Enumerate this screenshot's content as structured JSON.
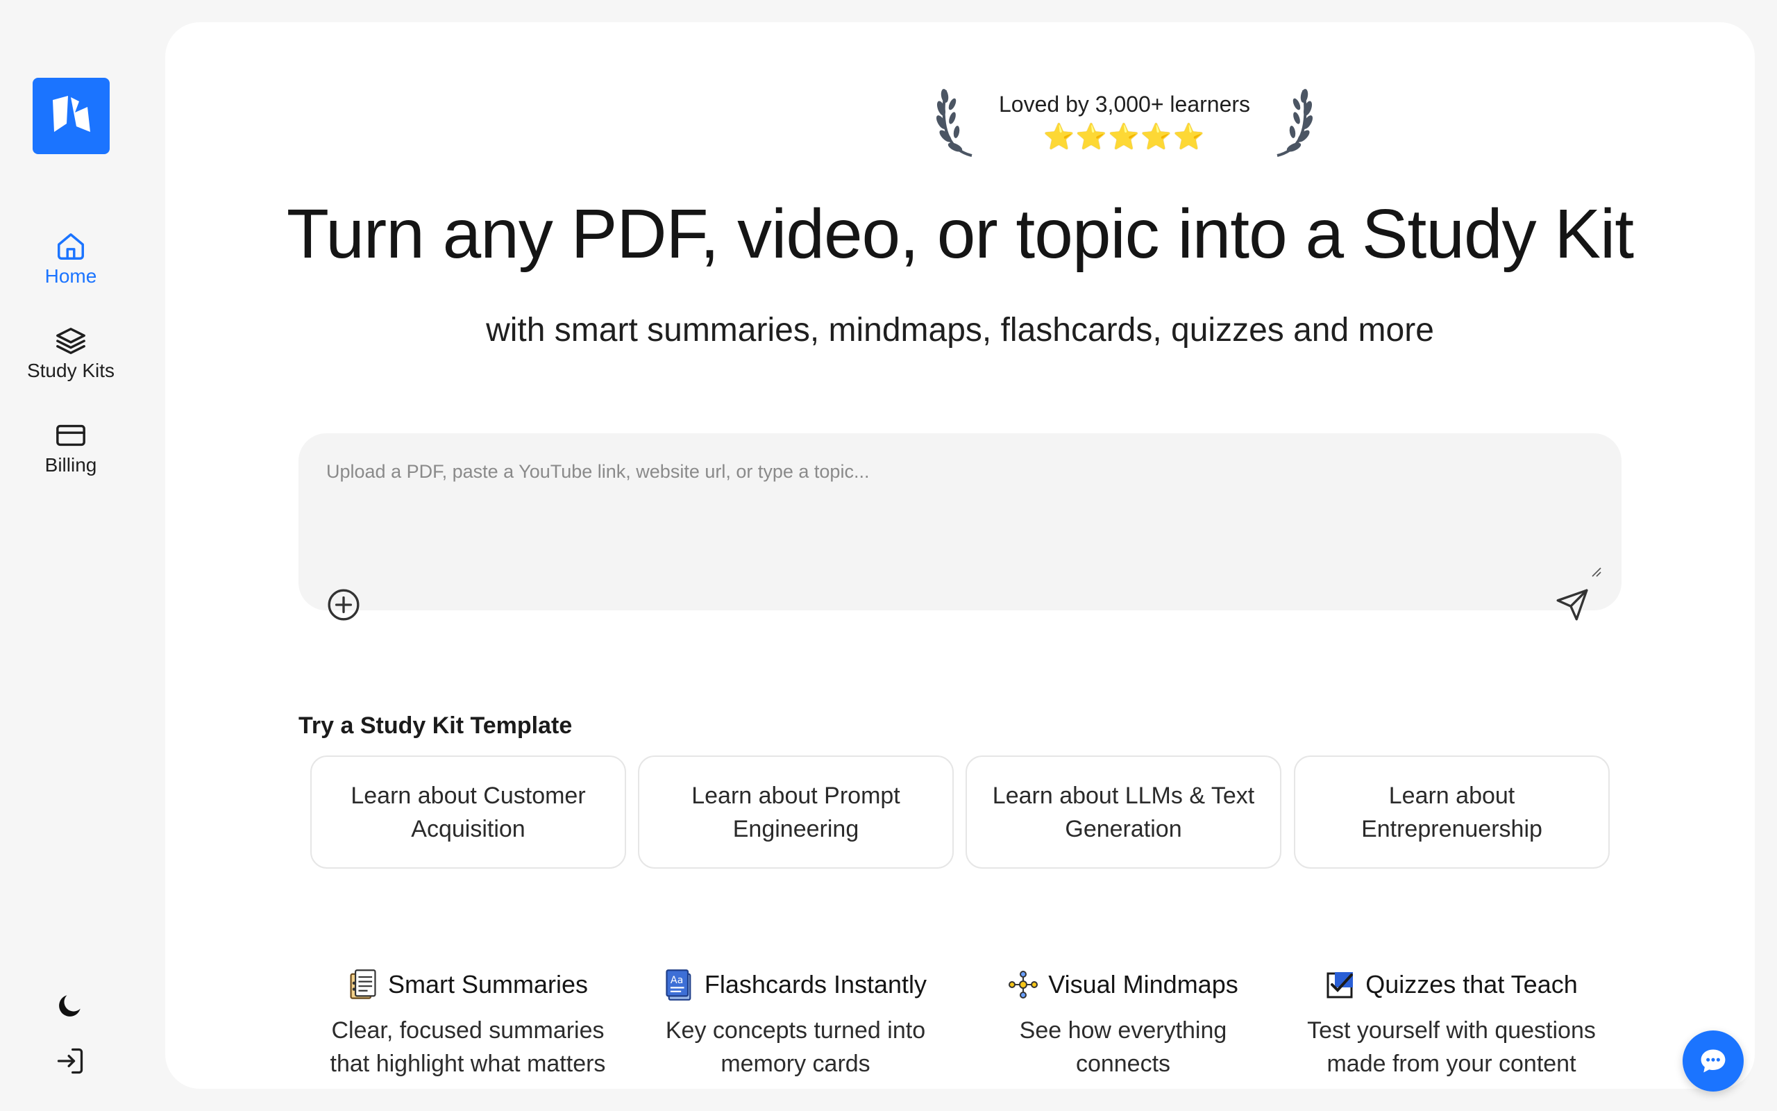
{
  "sidebar": {
    "logo_icon": "app-logo",
    "items": [
      {
        "label": "Home",
        "icon": "home-icon",
        "active": true
      },
      {
        "label": "Study Kits",
        "icon": "layers-icon",
        "active": false
      },
      {
        "label": "Billing",
        "icon": "credit-card-icon",
        "active": false
      }
    ],
    "theme_icon": "moon-icon",
    "signin_icon": "sign-in-icon"
  },
  "badge": {
    "text": "Loved by 3,000+ learners",
    "stars": "⭐⭐⭐⭐⭐",
    "rating": 5
  },
  "hero": {
    "title": "Turn any PDF, video, or topic into a Study Kit",
    "subtitle": "with smart summaries, mindmaps, flashcards, quizzes and more"
  },
  "input": {
    "placeholder": "Upload a PDF, paste a YouTube link, website url, or type a topic...",
    "value": ""
  },
  "templates": {
    "title": "Try a Study Kit Template",
    "items": [
      "Learn about Customer Acquisition",
      "Learn about Prompt Engineering",
      "Learn about LLMs & Text Generation",
      "Learn about Entreprenuership"
    ]
  },
  "features": [
    {
      "title": "Smart Summaries",
      "desc": "Clear, focused summaries that highlight what matters",
      "icon": "document-icon"
    },
    {
      "title": "Flashcards Instantly",
      "desc": "Key concepts turned into memory cards",
      "icon": "flashcard-icon"
    },
    {
      "title": "Visual Mindmaps",
      "desc": "See how everything connects",
      "icon": "mindmap-icon"
    },
    {
      "title": "Quizzes that Teach",
      "desc": "Test yourself with questions made from your content",
      "icon": "checkbox-icon"
    }
  ],
  "colors": {
    "accent": "#1b74ff",
    "background": "#f6f6f6",
    "panel": "#ffffff",
    "star": "#f5c518"
  },
  "chat_icon": "chat-bubble-icon"
}
